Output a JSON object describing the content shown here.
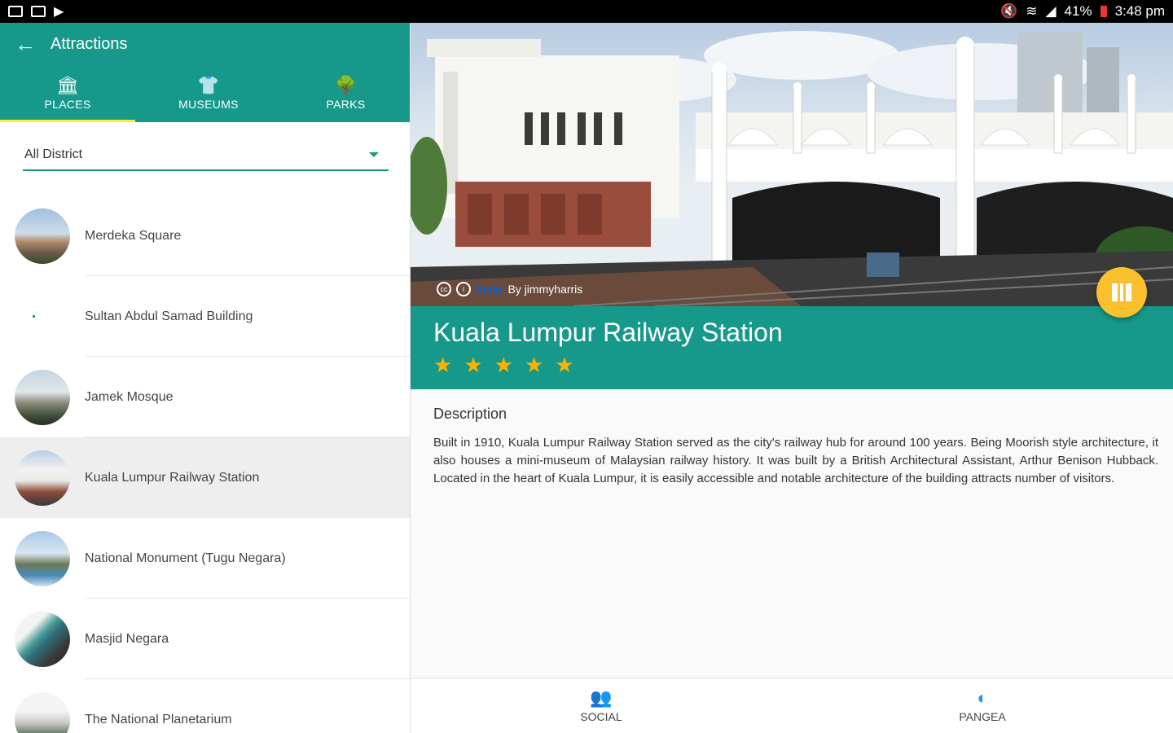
{
  "status_bar": {
    "battery": "41%",
    "time": "3:48 pm"
  },
  "appbar": {
    "title": "Attractions"
  },
  "tabs": [
    {
      "label": "PLACES",
      "icon": "place-icon",
      "active": true
    },
    {
      "label": "MUSEUMS",
      "icon": "museum-icon",
      "active": false
    },
    {
      "label": "PARKS",
      "icon": "park-icon",
      "active": false
    }
  ],
  "filter": {
    "selected": "All District"
  },
  "attractions": [
    {
      "label": "Merdeka Square",
      "selected": false
    },
    {
      "label": "Sultan Abdul Samad Building",
      "selected": false
    },
    {
      "label": "Jamek Mosque",
      "selected": false
    },
    {
      "label": "Kuala Lumpur Railway Station",
      "selected": true
    },
    {
      "label": "National Monument (Tugu Negara)",
      "selected": false
    },
    {
      "label": "Masjid Negara",
      "selected": false
    },
    {
      "label": "The National Planetarium",
      "selected": false
    }
  ],
  "detail": {
    "photo_credit": "By jimmyharris",
    "credit_source": "flickr",
    "title": "Kuala Lumpur Railway Station",
    "rating": 5,
    "description_heading": "Description",
    "description": "Built in 1910, Kuala Lumpur Railway Station served as the city's railway hub for around 100 years. Being Moorish style architecture, it also houses a mini-museum of Malaysian railway history. It was built by a British Architectural Assistant, Arthur Benison Hubback. Located in the heart of Kuala Lumpur, it is easily accessible and notable architecture of the building attracts number of visitors."
  },
  "bottom_nav": [
    {
      "label": "SOCIAL",
      "icon": "people-icon"
    },
    {
      "label": "PANGEA",
      "icon": "pangea-icon"
    }
  ],
  "colors": {
    "primary": "#16998a",
    "accent": "#fbc02d",
    "star": "#ffb300",
    "tab_indicator": "#ffeb3b"
  }
}
